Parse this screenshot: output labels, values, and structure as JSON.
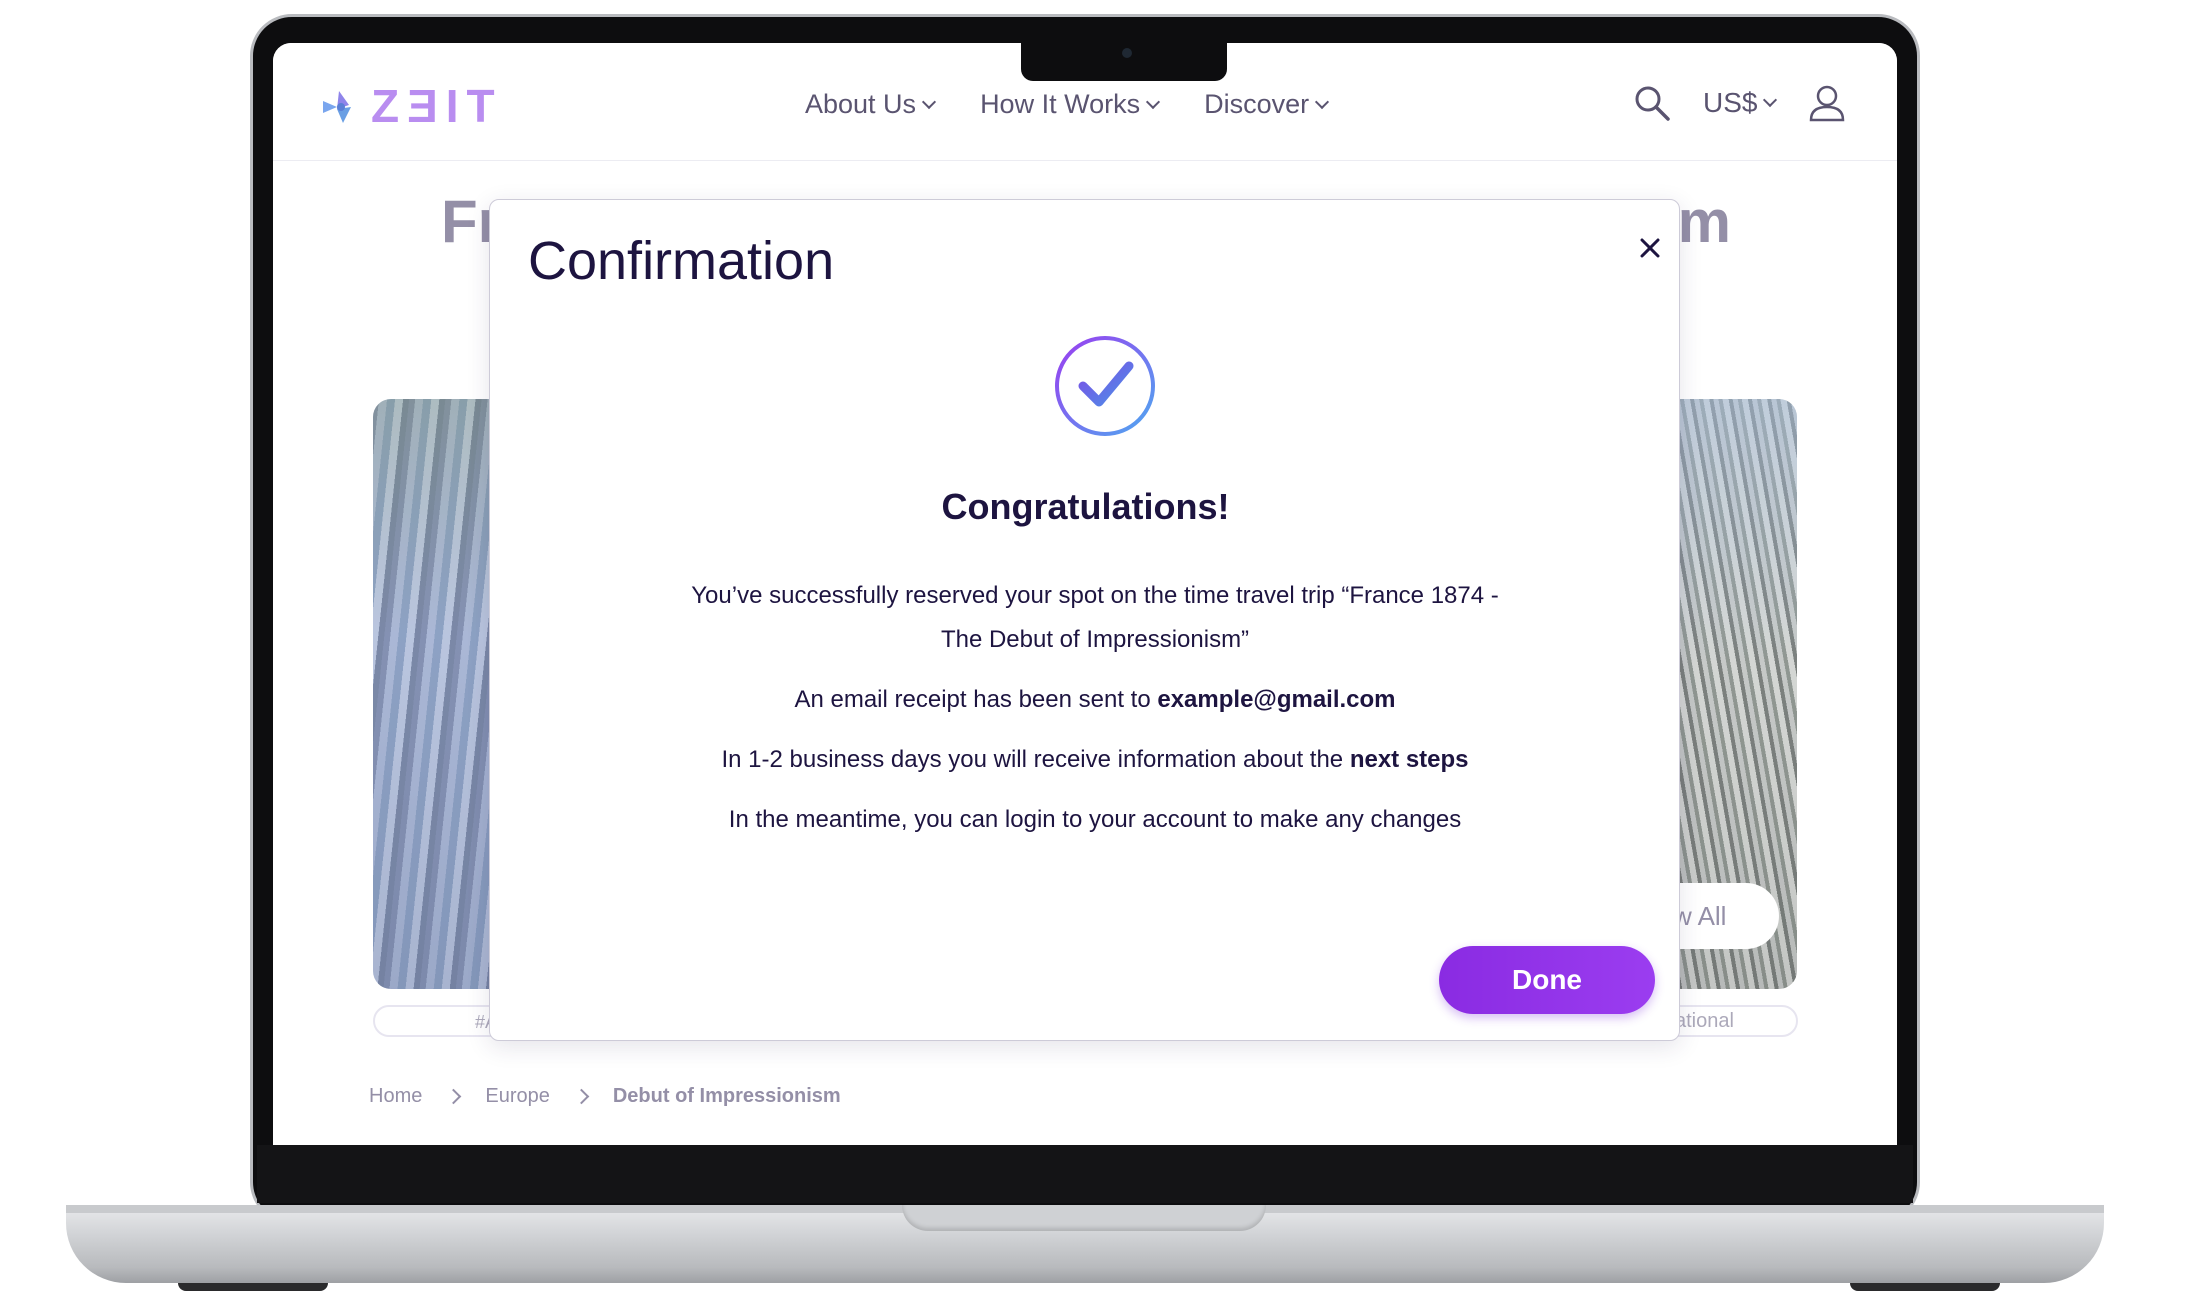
{
  "header": {
    "logo_text": "ZƎIT",
    "nav": [
      {
        "label": "About Us"
      },
      {
        "label": "How It Works"
      },
      {
        "label": "Discover"
      }
    ],
    "currency": "US$"
  },
  "page": {
    "title_left": "Fr",
    "title_right": "m",
    "view_all_label": "w All",
    "tag_left": "#A",
    "tag_right": "ational",
    "breadcrumb": [
      "Home",
      "Europe",
      "Debut of Impressionism"
    ]
  },
  "modal": {
    "title": "Confirmation",
    "close_glyph": "✕",
    "heading": "Congratulations!",
    "line1_a": "You’ve successfully reserved your spot on the time travel trip “France 1874 -",
    "line1_b": "The Debut of Impressionism”",
    "line2_prefix": "An email receipt has been sent to ",
    "line2_email": "example@gmail.com",
    "line3_prefix": "In 1-2 business days you will receive information about the ",
    "line3_bold": "next steps",
    "line4": "In the meantime, you can login to your account to make any changes",
    "done_label": "Done"
  },
  "colors": {
    "accent": "#8a2be2",
    "logo": "#b98df0",
    "text_dark": "#1d1440",
    "nav_text": "#5a5470"
  },
  "icons": {
    "logo": "zeit-logo-icon",
    "search": "search-icon",
    "user": "user-icon",
    "check": "check-circle-icon",
    "close": "close-icon"
  }
}
